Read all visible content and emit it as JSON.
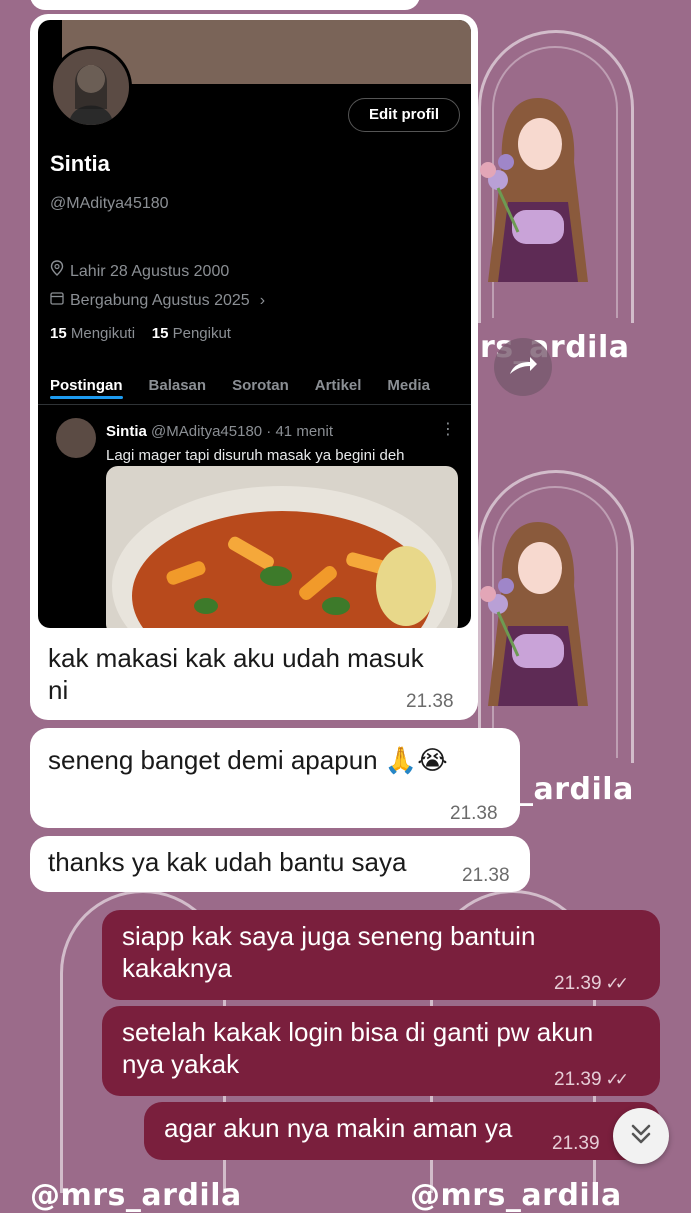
{
  "profile_screenshot": {
    "edit_button": "Edit profil",
    "name": "Sintia",
    "handle": "@MAditya45180",
    "birth": "Lahir 28 Agustus 2000",
    "joined": "Bergabung Agustus 2025",
    "following_count": "15",
    "following_label": "Mengikuti",
    "followers_count": "15",
    "followers_label": "Pengikut",
    "tabs": [
      "Postingan",
      "Balasan",
      "Sorotan",
      "Artikel",
      "Media"
    ],
    "post": {
      "author": "Sintia",
      "meta": "@MAditya45180 · 41 menit",
      "text": "Lagi mager tapi disuruh masak ya begini deh"
    }
  },
  "messages": [
    {
      "direction": "in",
      "line1": "kak makasi kak aku udah masuk",
      "line2": "ni",
      "time": "21.38"
    },
    {
      "direction": "in",
      "text": "seneng banget demi apapun 🙏😭",
      "time": "21.38"
    },
    {
      "direction": "in",
      "text": "thanks ya kak udah bantu saya",
      "time": "21.38"
    },
    {
      "direction": "out",
      "line1": "siapp kak saya juga seneng bantuin",
      "line2": "kakaknya",
      "time": "21.39"
    },
    {
      "direction": "out",
      "line1": "setelah kakak login bisa di ganti pw akun",
      "line2": "nya yakak",
      "time": "21.39"
    },
    {
      "direction": "out",
      "text": "agar akun nya makin aman ya",
      "time": "21.39"
    }
  ],
  "watermarks": [
    "rs_ardila",
    "_ardila",
    "@mrs_ardila",
    "@mrs_ardila"
  ],
  "colors": {
    "background": "#9b6b8a",
    "incoming_bubble": "#ffffff",
    "outgoing_bubble": "#7a1f3d",
    "accent_tab": "#1d9bf0"
  },
  "icons": {
    "forward": "forward-icon",
    "scroll_down": "double-chevron-down-icon",
    "read": "double-check-icon"
  }
}
